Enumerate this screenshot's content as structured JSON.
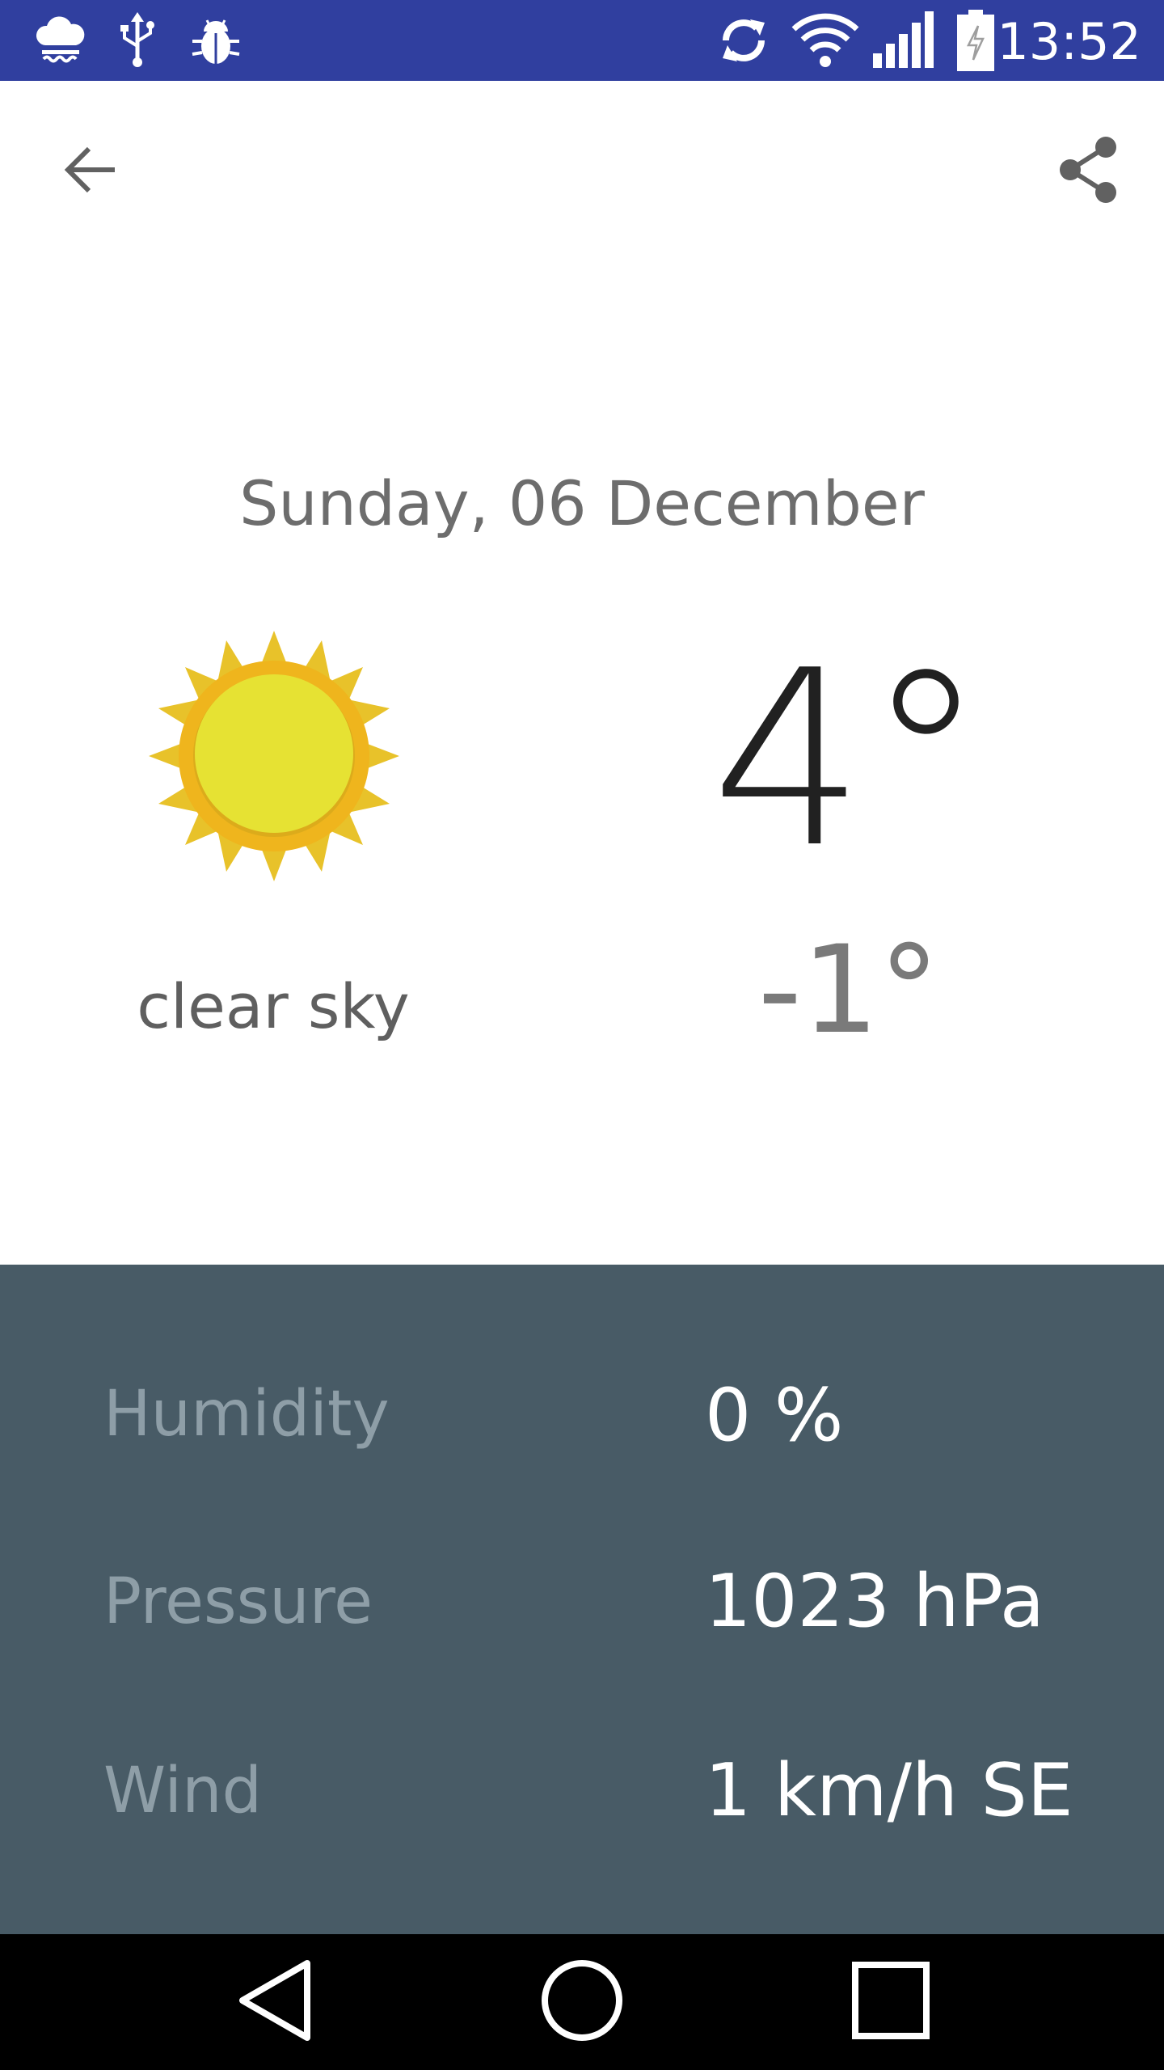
{
  "status_bar": {
    "time": "13:52",
    "left_icons": [
      "weather-rain-icon",
      "usb-icon",
      "bug-icon"
    ],
    "right_icons": [
      "sync-icon",
      "wifi-icon",
      "signal-icon",
      "battery-charging-icon"
    ],
    "background_color": "#303f9f"
  },
  "app_bar": {
    "back_icon": "arrow-back-icon",
    "share_icon": "share-icon"
  },
  "forecast": {
    "date": "Sunday, 06 December",
    "icon": "sun-icon",
    "description": "clear sky",
    "high": "4°",
    "low": "-1°"
  },
  "details": {
    "background_color": "#485b66",
    "rows": [
      {
        "label": "Humidity",
        "value": "0 %"
      },
      {
        "label": "Pressure",
        "value": "1023 hPa"
      },
      {
        "label": "Wind",
        "value": "1 km/h SE"
      }
    ]
  },
  "nav_bar": {
    "icons": [
      "nav-back-icon",
      "nav-home-icon",
      "nav-recents-icon"
    ]
  }
}
